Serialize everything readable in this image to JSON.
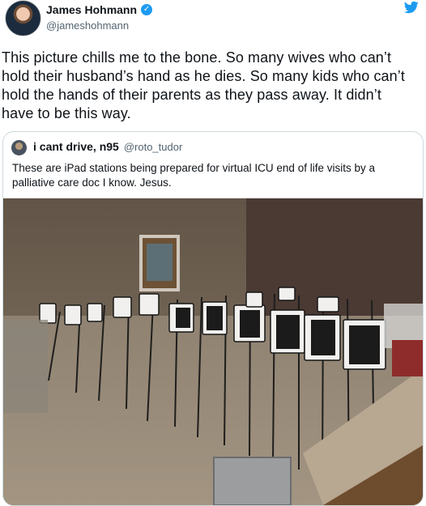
{
  "tweet": {
    "author_name": "James Hohmann",
    "author_handle": "@jameshohmann",
    "verified_icon": "verified-badge-icon",
    "platform_icon": "twitter-bird-icon",
    "lines": [
      "This picture chills me to the bone. So many wives who can’t",
      "hold their husband’s hand as he dies. So many kids who can’t",
      "hold the hands of their parents as they pass away. It didn’t",
      "have to be this way."
    ]
  },
  "quoted": {
    "author_name": "i cant drive, n95",
    "author_handle": "@roto_tudor",
    "lines": [
      "These are iPad stations being prepared for virtual ICU end of life visits by a",
      "palliative care doc I know. Jesus."
    ]
  },
  "colors": {
    "accent": "#1d9bf0",
    "text": "#0f1419",
    "muted": "#536471",
    "border": "#cfd9de"
  }
}
